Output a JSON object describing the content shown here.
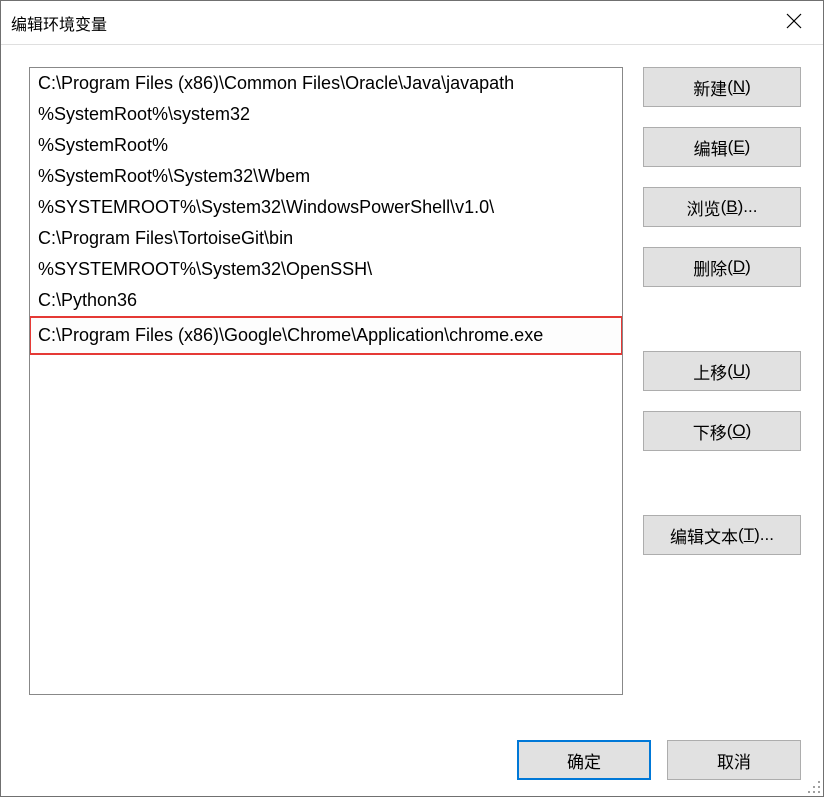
{
  "window": {
    "title": "编辑环境变量"
  },
  "list": {
    "items": [
      "C:\\Program Files (x86)\\Common Files\\Oracle\\Java\\javapath",
      "%SystemRoot%\\system32",
      "%SystemRoot%",
      "%SystemRoot%\\System32\\Wbem",
      "%SYSTEMROOT%\\System32\\WindowsPowerShell\\v1.0\\",
      "C:\\Program Files\\TortoiseGit\\bin",
      "%SYSTEMROOT%\\System32\\OpenSSH\\",
      "C:\\Python36",
      "C:\\Program Files (x86)\\Google\\Chrome\\Application\\chrome.exe"
    ],
    "highlighted_index": 8
  },
  "buttons": {
    "new": {
      "label": "新建",
      "accel": "N"
    },
    "edit": {
      "label": "编辑",
      "accel": "E"
    },
    "browse": {
      "label": "浏览",
      "accel": "B",
      "suffix": "..."
    },
    "delete": {
      "label": "删除",
      "accel": "D"
    },
    "move_up": {
      "label": "上移",
      "accel": "U"
    },
    "move_down": {
      "label": "下移",
      "accel": "O"
    },
    "edit_text": {
      "label": "编辑文本",
      "accel": "T",
      "suffix": "..."
    }
  },
  "footer": {
    "ok": "确定",
    "cancel": "取消"
  }
}
